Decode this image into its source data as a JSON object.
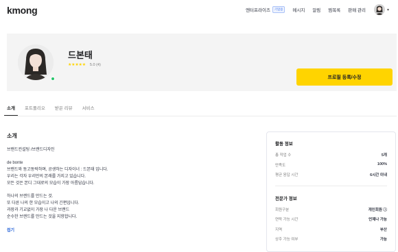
{
  "header": {
    "logo": "kmong",
    "nav": {
      "enterprise_label": "엔터프라이즈",
      "enterprise_badge": "기업용",
      "messages": "메시지",
      "notifications": "알림",
      "bookmarks": "찜목록",
      "sales_management": "판매 관리"
    }
  },
  "profile": {
    "name": "드본태",
    "stars": "★★★★★",
    "rating_text": "5.0 (4)",
    "cta_label": "프로필 등록/수정"
  },
  "tabs": [
    {
      "label": "소개",
      "active": true
    },
    {
      "label": "포트폴리오",
      "active": false
    },
    {
      "label": "받은 리뷰",
      "active": false
    },
    {
      "label": "서비스",
      "active": false
    }
  ],
  "intro": {
    "title": "소개",
    "category": "브랜드컨설팅 /브랜드디자인",
    "para1": [
      "de bonte",
      "브랜드와 동고동락하며, 공생하는 디자이너 : 드본태 입니다.",
      "우리는 각자 우리만의 본래를 가지고 있습니다.",
      "모든 것은 본디 그대로의 모습이 가장 아름답습니다."
    ],
    "para2": [
      "하나의 브랜드를 만드는 것.",
      "또 다른 나의 한 모습이고 나의 긴편입니다.",
      "과장과 기교없이 가장 나 다운 브랜드",
      "순수한 브랜드를 만드는 것을 지향합니다."
    ],
    "more_label": "접기"
  },
  "activity": {
    "title": "활동 정보",
    "rows": [
      {
        "key": "총 작업 수",
        "value": "5개"
      },
      {
        "key": "만족도",
        "value": "100%"
      },
      {
        "key": "평균 응답 시간",
        "value": "6시간 이내"
      }
    ]
  },
  "expert": {
    "title": "전문가 정보",
    "rows": [
      {
        "key": "회원구분",
        "value": "개인회원 ⓘ"
      },
      {
        "key": "연락 가능 시간",
        "value": "언제나 가능"
      },
      {
        "key": "지역",
        "value": "부산"
      },
      {
        "key": "상주 가능 여부",
        "value": "가능"
      }
    ]
  },
  "colors": {
    "accent_yellow": "#ffd400",
    "link_blue": "#2a66d9",
    "online_green": "#27c46b",
    "badge_blue": "#4a7cf0"
  }
}
